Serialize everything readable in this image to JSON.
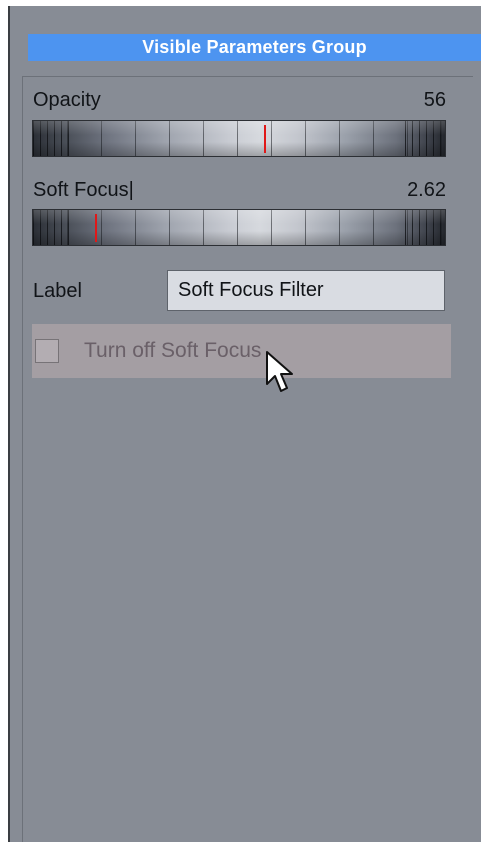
{
  "panel": {
    "title": "Visible Parameters Group"
  },
  "parameters": [
    {
      "label": "Opacity",
      "value": "56",
      "level": 0.56
    },
    {
      "label": "Soft Focus|",
      "value": "2.62",
      "level": 0.15
    }
  ],
  "label_field": {
    "label": "Label",
    "value": "Soft Focus Filter"
  },
  "toggle": {
    "label": "Turn off Soft Focus",
    "checked": false
  },
  "colors": {
    "header_bg": "#4d94f0",
    "panel_bg": "#878c95",
    "indicator": "#e01818",
    "checkbox_row_bg": "#a49ea3"
  },
  "icons": {
    "cursor": "mouse-pointer-icon"
  }
}
